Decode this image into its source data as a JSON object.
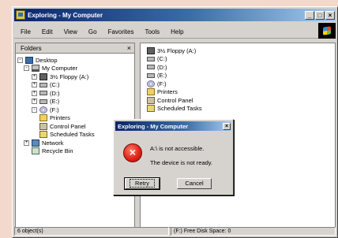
{
  "window": {
    "title": "Exploring - My Computer",
    "buttons": {
      "minimize": "_",
      "maximize": "□",
      "close": "×"
    }
  },
  "menu": [
    "File",
    "Edit",
    "View",
    "Go",
    "Favorites",
    "Tools",
    "Help"
  ],
  "folders_pane": {
    "header": "Folders",
    "close": "×",
    "tree": [
      {
        "label": "Desktop",
        "exp": "-",
        "icon": "desktop"
      },
      {
        "label": "My Computer",
        "exp": "-",
        "icon": "computer"
      },
      {
        "label": "3½ Floppy (A:)",
        "exp": "+",
        "icon": "floppy"
      },
      {
        "label": "(C:)",
        "exp": "+",
        "icon": "drive"
      },
      {
        "label": "(D:)",
        "exp": "+",
        "icon": "drive"
      },
      {
        "label": "(E:)",
        "exp": "+",
        "icon": "drive"
      },
      {
        "label": "(F:)",
        "exp": "-",
        "icon": "cd"
      },
      {
        "label": "Printers",
        "exp": "",
        "icon": "folder"
      },
      {
        "label": "Control Panel",
        "exp": "",
        "icon": "ctrl"
      },
      {
        "label": "Scheduled Tasks",
        "exp": "",
        "icon": "sched"
      },
      {
        "label": "Network",
        "exp": "+",
        "icon": "network"
      },
      {
        "label": "Recycle Bin",
        "exp": "",
        "icon": "recycle"
      }
    ]
  },
  "contents": [
    {
      "label": "3½ Floppy (A:)",
      "icon": "floppy"
    },
    {
      "label": "(C:)",
      "icon": "drive"
    },
    {
      "label": "(D:)",
      "icon": "drive"
    },
    {
      "label": "(E:)",
      "icon": "drive"
    },
    {
      "label": "(F:)",
      "icon": "cd"
    },
    {
      "label": "Printers",
      "icon": "folder"
    },
    {
      "label": "Control Panel",
      "icon": "ctrl"
    },
    {
      "label": "Scheduled Tasks",
      "icon": "sched"
    }
  ],
  "dialog": {
    "title": "Exploring - My Computer",
    "close": "×",
    "icon_glyph": "×",
    "line1": "A:\\ is not accessible.",
    "line2": "The device is not ready.",
    "retry": "Retry",
    "cancel": "Cancel"
  },
  "status": {
    "left": "6 object(s)",
    "right": "(F:) Free Disk Space: 0"
  }
}
